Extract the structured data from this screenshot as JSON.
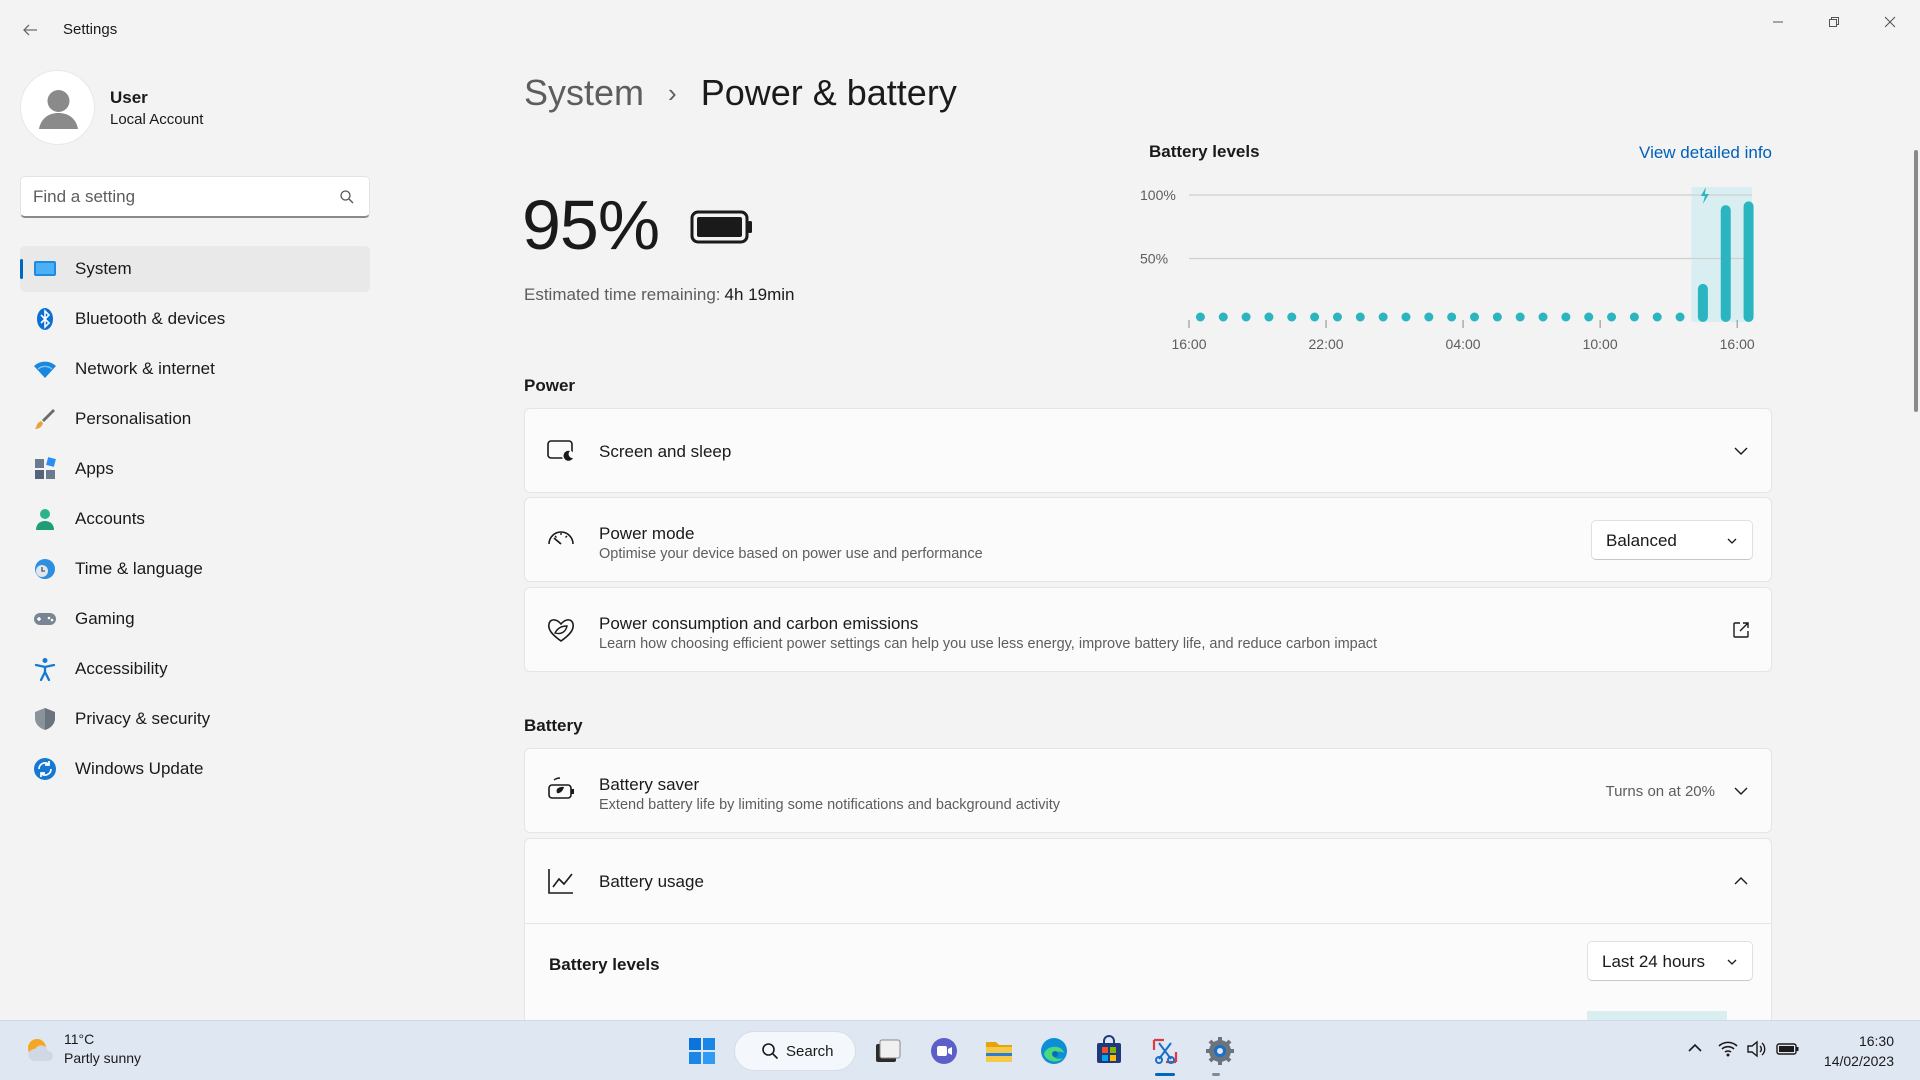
{
  "window": {
    "title": "Settings"
  },
  "profile": {
    "name": "User",
    "account_type": "Local Account"
  },
  "search": {
    "placeholder": "Find a setting"
  },
  "sidebar": {
    "items": [
      {
        "label": "System",
        "icon": "system-icon",
        "active": true
      },
      {
        "label": "Bluetooth & devices",
        "icon": "bluetooth-icon"
      },
      {
        "label": "Network & internet",
        "icon": "wifi-icon"
      },
      {
        "label": "Personalisation",
        "icon": "brush-icon"
      },
      {
        "label": "Apps",
        "icon": "apps-icon"
      },
      {
        "label": "Accounts",
        "icon": "person-icon"
      },
      {
        "label": "Time & language",
        "icon": "clock-globe-icon"
      },
      {
        "label": "Gaming",
        "icon": "gamepad-icon"
      },
      {
        "label": "Accessibility",
        "icon": "accessibility-icon"
      },
      {
        "label": "Privacy & security",
        "icon": "shield-icon"
      },
      {
        "label": "Windows Update",
        "icon": "update-icon"
      }
    ]
  },
  "breadcrumb": {
    "parent": "System",
    "separator": "›",
    "current": "Power & battery"
  },
  "battery": {
    "percent_label": "95%",
    "estimate_label": "Estimated time remaining:",
    "estimate_value": "4h 19min"
  },
  "chart_data": {
    "type": "bar",
    "title": "Battery levels",
    "link": "View detailed info",
    "y_ticks": [
      "100%",
      "50%"
    ],
    "ylim": [
      0,
      100
    ],
    "x_ticks": [
      "16:00",
      "22:00",
      "04:00",
      "10:00",
      "16:00"
    ],
    "values": [
      0,
      0,
      0,
      0,
      0,
      0,
      0,
      0,
      0,
      0,
      0,
      0,
      0,
      0,
      0,
      0,
      0,
      0,
      0,
      0,
      0,
      0,
      30,
      92,
      95
    ],
    "charging_from_index": 22,
    "bar_color": "#2bb5c0",
    "charging_bg": "#d9eef0"
  },
  "power": {
    "section_label": "Power",
    "screen_sleep": {
      "title": "Screen and sleep"
    },
    "power_mode": {
      "title": "Power mode",
      "subtitle": "Optimise your device based on power use and performance",
      "selected": "Balanced"
    },
    "consumption": {
      "title": "Power consumption and carbon emissions",
      "subtitle": "Learn how choosing efficient power settings can help you use less energy, improve battery life, and reduce carbon impact"
    }
  },
  "battery_section": {
    "section_label": "Battery",
    "saver": {
      "title": "Battery saver",
      "subtitle": "Extend battery life by limiting some notifications and background activity",
      "status": "Turns on at 20%"
    },
    "usage": {
      "title": "Battery usage"
    },
    "levels": {
      "title": "Battery levels",
      "range": "Last 24 hours"
    }
  },
  "taskbar": {
    "weather": {
      "temp": "11°C",
      "desc": "Partly sunny"
    },
    "search_label": "Search",
    "time": "16:30",
    "date": "14/02/2023"
  },
  "colors": {
    "accent": "#0067c0",
    "link": "#0060b8",
    "chart": "#2bb5c0"
  }
}
